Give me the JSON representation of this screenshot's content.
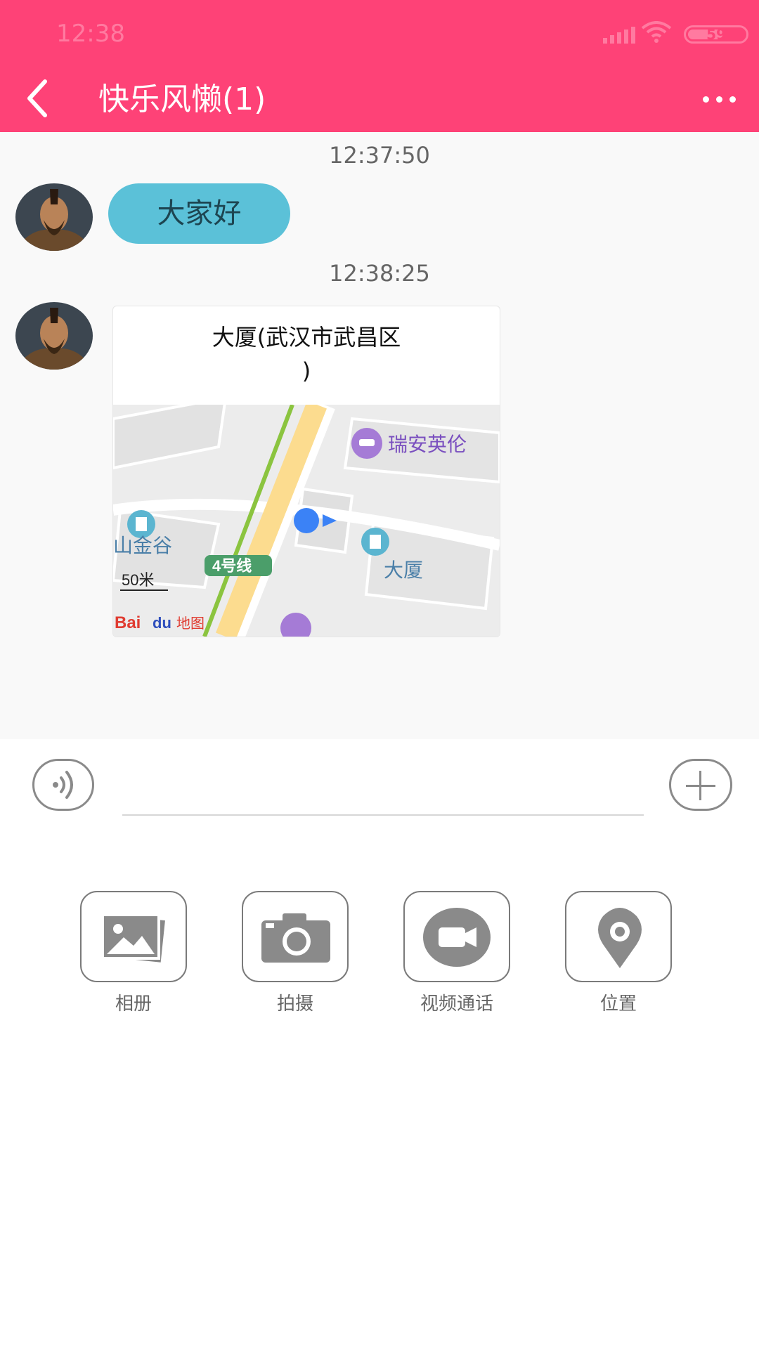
{
  "status_bar": {
    "time": "12:38",
    "battery": "59"
  },
  "header": {
    "title": "快乐风懒(1)"
  },
  "messages": [
    {
      "time": "12:37:50",
      "text": "大家好"
    },
    {
      "time": "12:38:25",
      "location_title": "大厦(武汉市武昌区",
      "location_suffix": ")",
      "map": {
        "poi_hotel": "瑞安英伦",
        "poi_mall": "山金谷",
        "metro_line": "4号线",
        "building": "大厦",
        "scale": "50米",
        "brand": "Bai",
        "brand_logo_text": "du",
        "brand_suffix": "地图"
      }
    }
  ],
  "tools": [
    {
      "label": "相册",
      "icon": "photo-album-icon"
    },
    {
      "label": "拍摄",
      "icon": "camera-icon"
    },
    {
      "label": "视频通话",
      "icon": "video-call-icon"
    },
    {
      "label": "位置",
      "icon": "location-pin-icon"
    }
  ],
  "colors": {
    "accent": "#fe4277",
    "bubble": "#5bc1d8",
    "icon_gray": "#8a8a8a"
  }
}
